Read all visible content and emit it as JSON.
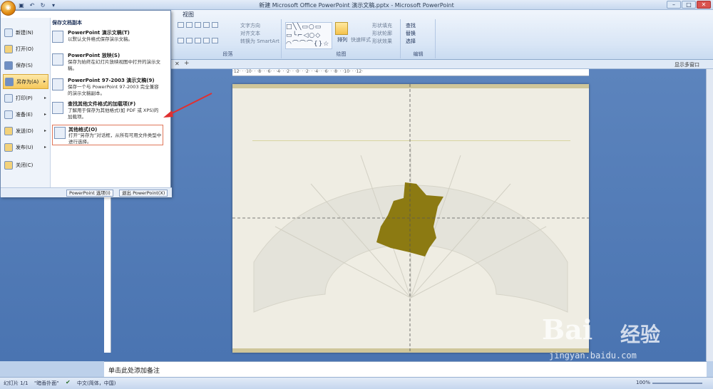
{
  "window": {
    "title": "新建 Microsoft Office PowerPoint 演示文稿.pptx - Microsoft PowerPoint",
    "minimize": "–",
    "maximize": "□",
    "close": "✕",
    "icon": "office-button-icon"
  },
  "ribbon": {
    "visible_tab": "视图",
    "groups": [
      {
        "label": "段落",
        "items": [
          "文字方向",
          "对齐文本",
          "转换为 SmartArt"
        ]
      },
      {
        "label": "绘图",
        "items": [
          "排列",
          "快速样式",
          "形状填充",
          "形状轮廓",
          "形状效果"
        ]
      },
      {
        "label": "编辑",
        "items": [
          "查找",
          "替换",
          "选择"
        ]
      }
    ]
  },
  "docbar": {
    "tab_close": "✕",
    "add": "+",
    "show_window": "显示多窗口"
  },
  "ruler": {
    "ticks": "·12·  ·  ·10·  ·  ·8·  ·  ·6·  ·  ·4·  ·  ·2·  ·  ·0·  ·  ·2·  ·  ·4·  ·  ·6·  ·  ·8·  ·  ·10·  ·  ·12·"
  },
  "office_menu": {
    "left_items": [
      {
        "label": "新建(N)",
        "icon": "new-document-icon",
        "arrow": ""
      },
      {
        "label": "打开(O)",
        "icon": "open-folder-icon",
        "arrow": ""
      },
      {
        "label": "保存(S)",
        "icon": "save-disk-icon",
        "arrow": ""
      },
      {
        "label": "另存为(A)",
        "icon": "save-as-icon",
        "arrow": "▸"
      },
      {
        "label": "打印(P)",
        "icon": "printer-icon",
        "arrow": "▸"
      },
      {
        "label": "准备(E)",
        "icon": "prepare-icon",
        "arrow": "▸"
      },
      {
        "label": "发送(D)",
        "icon": "send-icon",
        "arrow": "▸"
      },
      {
        "label": "发布(U)",
        "icon": "publish-icon",
        "arrow": "▸"
      },
      {
        "label": "关闭(C)",
        "icon": "close-folder-icon",
        "arrow": ""
      }
    ],
    "submenu_header": "保存文档副本",
    "submenu": [
      {
        "title": "PowerPoint 演示文稿(T)",
        "desc": "以默认文件格式保存演示文稿。"
      },
      {
        "title": "PowerPoint 放映(S)",
        "desc": "保存为始终在幻灯片放映视图中打开的演示文稿。"
      },
      {
        "title": "PowerPoint 97-2003 演示文稿(9)",
        "desc": "保存一个与 PowerPoint 97-2003 完全兼容的演示文稿副本。"
      },
      {
        "title": "查找其他文件格式的加载项(F)",
        "desc": "了解用于保存为其他格式(如 PDF 或 XPS)的加载项。"
      },
      {
        "title": "其他格式(O)",
        "desc": "打开“另存为”对话框，从所有可用文件类型中进行选择。"
      }
    ],
    "options_button": "PowerPoint 选项(I)",
    "exit_button": "退出 PowerPoint(X)"
  },
  "notes": {
    "placeholder": "单击此处添加备注"
  },
  "status": {
    "slide": "幻灯片 1/1",
    "theme": "\"暗香扑面\"",
    "language": "中文(简体，中国)",
    "zoom": "100%"
  },
  "watermark": {
    "brand": "Bai",
    "brand_cn": "经验",
    "url": "jingyan.baidu.com"
  },
  "colors": {
    "accent": "#f6c85b",
    "highlight_border": "#e0775a",
    "arrow": "#e03030",
    "slide_shape": "#8c7a12"
  }
}
